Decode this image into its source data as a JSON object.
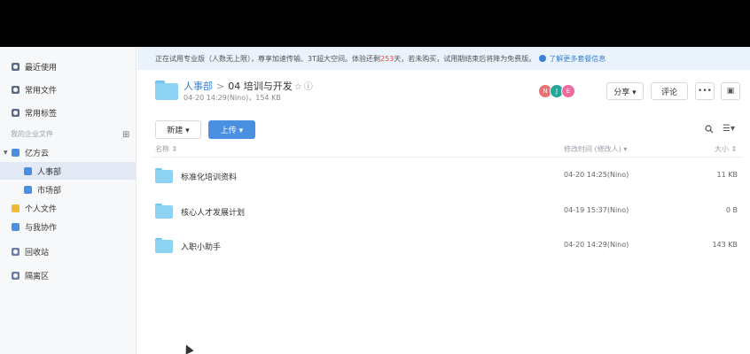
{
  "sidebar": {
    "items": [
      {
        "label": "最近使用",
        "icon": "clock-icon"
      },
      {
        "label": "常用文件",
        "icon": "star-file-icon"
      },
      {
        "label": "常用标签",
        "icon": "tag-icon"
      }
    ],
    "section_label": "我的企业文件",
    "org": {
      "label": "亿方云",
      "icon": "company-icon"
    },
    "departments": [
      {
        "label": "人事部",
        "icon": "department-icon",
        "active": true
      },
      {
        "label": "市场部",
        "icon": "department-icon",
        "active": false
      }
    ],
    "bottom_items": [
      {
        "label": "个人文件",
        "icon": "person-icon"
      },
      {
        "label": "与我协作",
        "icon": "collab-icon"
      },
      {
        "label": "回收站",
        "icon": "trash-icon"
      },
      {
        "label": "隔离区",
        "icon": "quarantine-icon"
      }
    ]
  },
  "notice": {
    "text_before": "正在试用专业版（人数无上限），尊享加速传输、3T超大空间。体验还剩",
    "days": "253",
    "text_after": "天，若未购买，试用期结束后将降为免费版。",
    "link": "了解更多套餐信息"
  },
  "header": {
    "parent": "人事部",
    "separator": ">",
    "title": "04 培训与开发",
    "star": "☆",
    "info": "ⓘ",
    "meta": "04-20 14:29(Nino)，154 KB",
    "avatars": [
      {
        "initial": "N",
        "color": "#e57373"
      },
      {
        "initial": "J",
        "color": "#26a69a"
      },
      {
        "initial": "E",
        "color": "#ec6b9c"
      }
    ],
    "share_label": "分享 ▾",
    "comment_label": "评论",
    "more_label": "•••",
    "panel_label": "▣"
  },
  "toolbar": {
    "new_label": "新建 ▾",
    "upload_label": "上传 ▾",
    "view_label": "☰▾"
  },
  "columns": {
    "name": "名称 ⇕",
    "modified": "修改时间 (修改人) ▾",
    "size": "大小 ⇕"
  },
  "files": [
    {
      "name": "标准化培训资料",
      "modified": "04-20 14:25(Nino)",
      "size": "11 KB"
    },
    {
      "name": "核心人才发展计划",
      "modified": "04-19 15:37(Nino)",
      "size": "0 B"
    },
    {
      "name": "入职小助手",
      "modified": "04-20 14:29(Nino)",
      "size": "143 KB"
    }
  ],
  "colors": {
    "accent": "#4a90e2",
    "folder": "#8fd3f4",
    "notice_bg": "#eaf2fb"
  }
}
